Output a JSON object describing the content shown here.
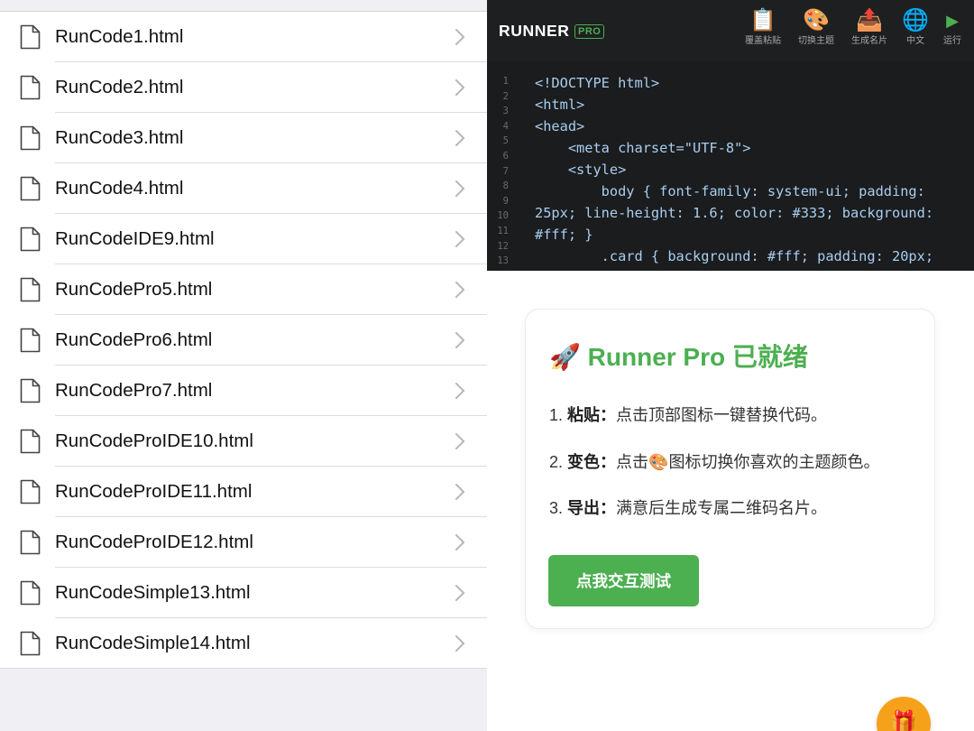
{
  "files": [
    "RunCode1.html",
    "RunCode2.html",
    "RunCode3.html",
    "RunCode4.html",
    "RunCodeIDE9.html",
    "RunCodePro5.html",
    "RunCodePro6.html",
    "RunCodePro7.html",
    "RunCodeProIDE10.html",
    "RunCodeProIDE11.html",
    "RunCodeProIDE12.html",
    "RunCodeSimple13.html",
    "RunCodeSimple14.html"
  ],
  "editor": {
    "brand": "RUNNER",
    "badge": "PRO",
    "toolbar": [
      {
        "icon": "📋",
        "icon_name": "clipboard-icon",
        "label": "覆盖粘贴"
      },
      {
        "icon": "🎨",
        "icon_name": "palette-icon",
        "label": "切换主题"
      },
      {
        "icon": "📤",
        "icon_name": "export-tray-icon",
        "label": "生成名片"
      },
      {
        "icon": "🌐",
        "icon_name": "globe-icon",
        "label": "中文"
      },
      {
        "icon": "▶",
        "icon_name": "play-icon",
        "label": "运行"
      }
    ],
    "line_numbers": [
      "1",
      "2",
      "3",
      "4",
      "5",
      "6",
      "7",
      "8",
      "9",
      "10",
      "11",
      "12",
      "13"
    ],
    "code_lines": [
      "<!DOCTYPE html>",
      "<html>",
      "<head>",
      "    <meta charset=\"UTF-8\">",
      "    <style>",
      "        body { font-family: system-ui; padding:",
      "25px; line-height: 1.6; color: #333; background:",
      "#fff; }",
      "        .card { background: #fff; padding: 20px;"
    ]
  },
  "preview": {
    "title_icon": "🚀",
    "title_text": "Runner Pro 已就绪",
    "steps": [
      {
        "num": "1.",
        "key": "粘贴",
        "sep": "：",
        "text": "点击顶部图标一键替换代码。"
      },
      {
        "num": "2.",
        "key": "变色",
        "sep": "：",
        "text_before": "点击",
        "icon": "🎨",
        "text_after": "图标切换你喜欢的主题颜色。"
      },
      {
        "num": "3.",
        "key": "导出",
        "sep": "：",
        "text": "满意后生成专属二维码名片。"
      }
    ],
    "button_label": "点我交互测试",
    "fab_icon": "🎁"
  },
  "colors": {
    "accent": "#4caf50",
    "fab": "#f5a21a",
    "editor_bg": "#1e1f21",
    "code_text": "#a8cef0"
  }
}
